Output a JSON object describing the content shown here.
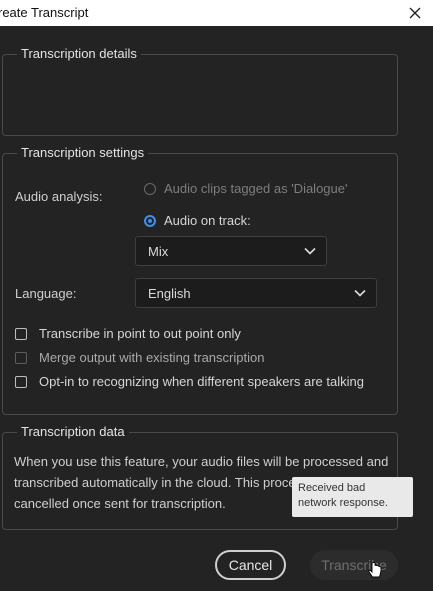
{
  "window": {
    "title": "reate Transcript"
  },
  "sections": {
    "details": {
      "legend": "Transcription details"
    },
    "settings": {
      "legend": "Transcription settings",
      "audio_analysis_label": "Audio analysis:",
      "option_dialogue": "Audio clips tagged as 'Dialogue'",
      "option_on_track": "Audio on track:",
      "track_value": "Mix",
      "language_label": "Language:",
      "language_value": "English",
      "checkbox_in_out": "Transcribe in point to out point only",
      "checkbox_merge": "Merge output with existing transcription",
      "checkbox_speakers": "Opt-in to recognizing when different speakers are talking"
    },
    "data": {
      "legend": "Transcription data",
      "line1": "When you use this feature, your audio files will be processed and",
      "line2": "transcribed automatically in the cloud. This process",
      "line3": "cancelled once sent for transcription."
    }
  },
  "tooltip": {
    "line1": "Received bad",
    "line2": "network response."
  },
  "buttons": {
    "cancel": "Cancel",
    "transcribe": "Transcribe"
  },
  "colors": {
    "accent": "#3d8eea",
    "background": "#232323"
  }
}
